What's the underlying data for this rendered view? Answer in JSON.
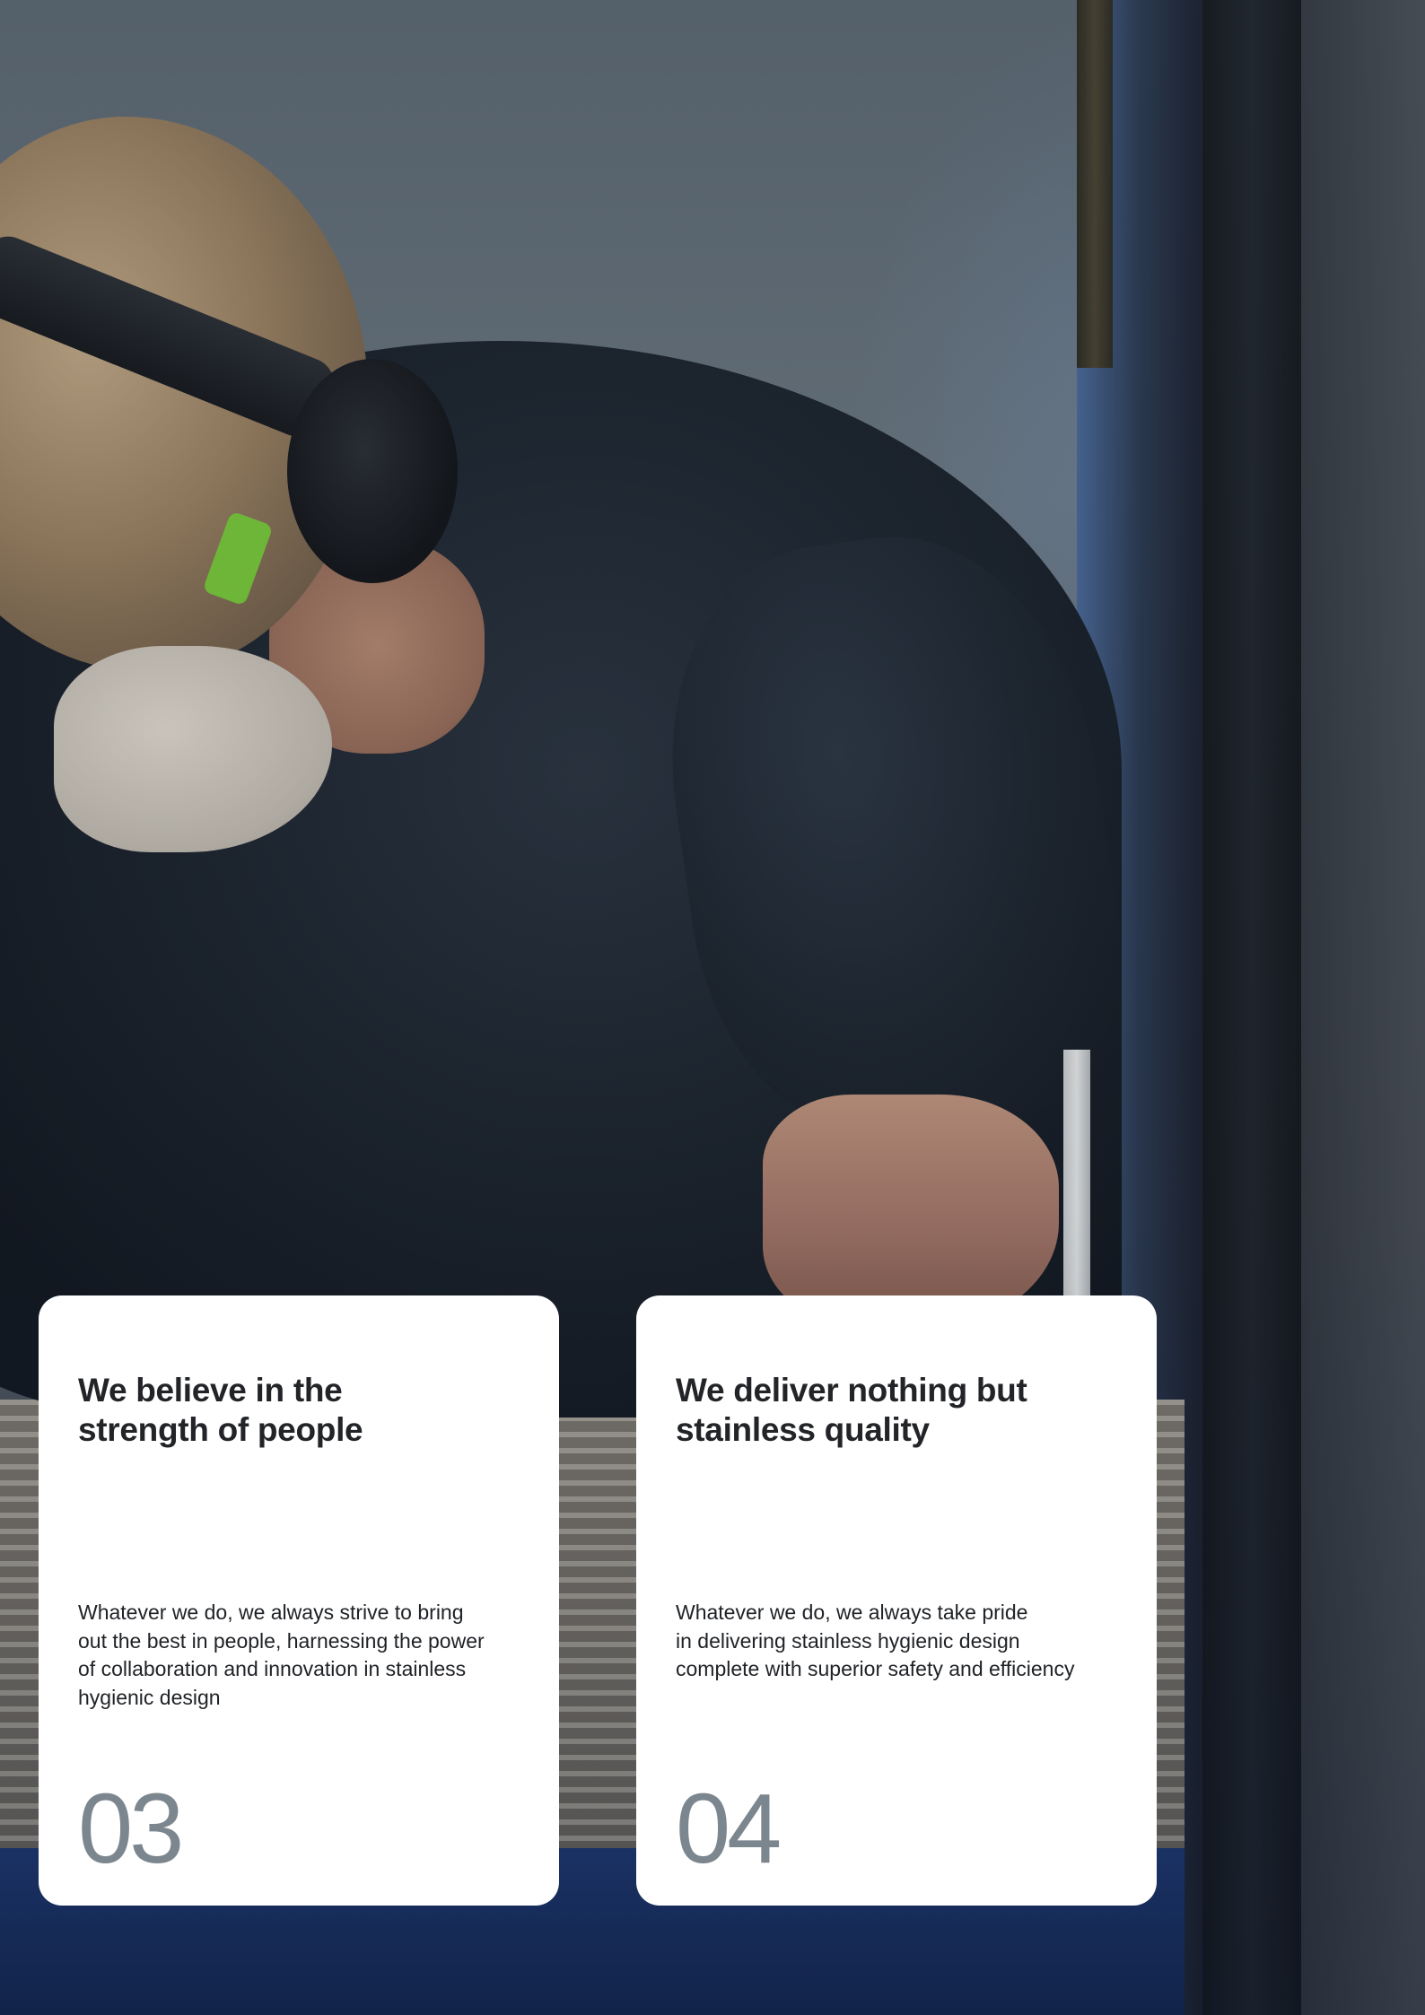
{
  "cards": [
    {
      "heading": "We believe in the\nstrength of people",
      "body": "Whatever we do, we always strive to bring\nout the best in people, harnessing the power\nof collaboration and innovation in stainless\nhygienic design",
      "number": "03"
    },
    {
      "heading": "We deliver nothing but\nstainless quality",
      "body": "Whatever we do, we always take pride\nin delivering stainless hygienic design\ncomplete with superior safety and efficiency",
      "number": "04"
    }
  ],
  "colors": {
    "card_background": "#ffffff",
    "heading_text": "#222428",
    "number_text": "#7c868e"
  }
}
